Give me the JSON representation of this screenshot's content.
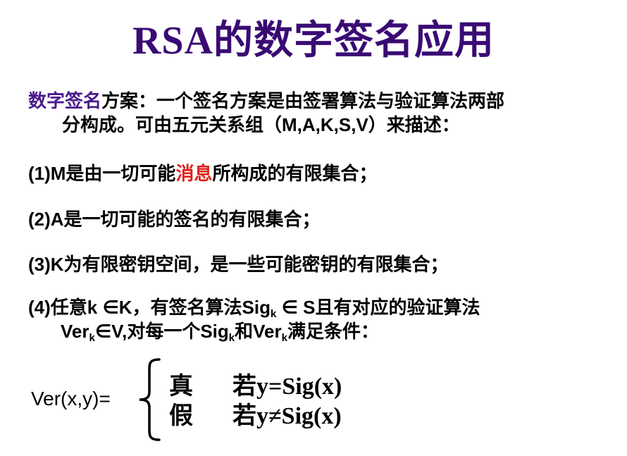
{
  "title": "RSA的数字签名应用",
  "intro": {
    "term": "数字签名",
    "line1_rest": "方案：一个签名方案是由签署算法与验证算法两部",
    "line2": "分构成。可由五元关系组（M,A,K,S,V）来描述："
  },
  "items": {
    "1": {
      "prefix": "(1)M是由一切可能",
      "highlight": "消息",
      "suffix": "所构成的有限集合；"
    },
    "2": {
      "text": "(2)A是一切可能的签名的有限集合；"
    },
    "3": {
      "text": "(3)K为有限密钥空间，是一些可能密钥的有限集合；"
    },
    "4": {
      "l1_a": "(4)任意k ∈K，有签名算法Sig",
      "l1_sub": "k",
      "l1_b": " ∈ S且有对应的验证算法",
      "l2_a": "Ver",
      "l2_sub1": "k",
      "l2_b": "∈V,对每一个Sig",
      "l2_sub2": "k",
      "l2_c": "和Ver",
      "l2_sub3": "k",
      "l2_d": "满足条件："
    }
  },
  "formula": {
    "label": "Ver(x,y)=",
    "case_true_value": "真",
    "case_true_cond": "若y=Sig(x)",
    "case_false_value": "假",
    "case_false_cond": "若y≠Sig(x)"
  },
  "colors": {
    "title": "#3a0a74",
    "term": "#4a1a8c",
    "highlight": "#e0201a"
  }
}
